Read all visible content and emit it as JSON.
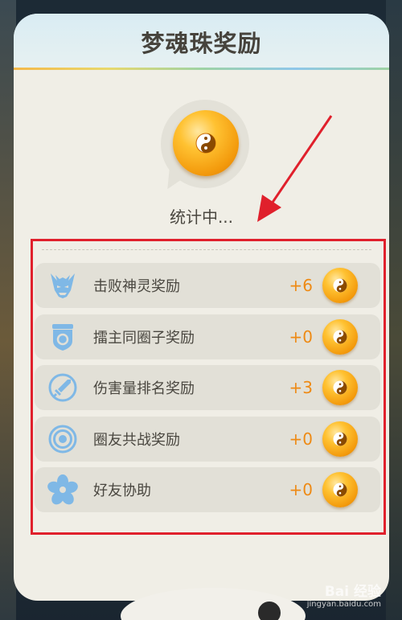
{
  "dialog": {
    "title": "梦魂珠奖励",
    "status": "统计中..."
  },
  "rewards": [
    {
      "label": "击败神灵奖励",
      "value": "+6",
      "icon": "demon-head-icon"
    },
    {
      "label": "擂主同圈子奖励",
      "value": "+0",
      "icon": "shield-badge-icon"
    },
    {
      "label": "伤害量排名奖励",
      "value": "+3",
      "icon": "sword-circle-icon"
    },
    {
      "label": "圈友共战奖励",
      "value": "+0",
      "icon": "target-rings-icon"
    },
    {
      "label": "好友协助",
      "value": "+0",
      "icon": "flower-icon"
    }
  ],
  "watermark": {
    "brand": "Bai 经验",
    "url": "jingyan.baidu.com"
  },
  "colors": {
    "accent_orange": "#ee8a14",
    "annotation_red": "#e0202c",
    "panel_bg": "#f0eee6",
    "row_bg": "#e2e0d7",
    "icon_blue": "#7fb8e6"
  }
}
